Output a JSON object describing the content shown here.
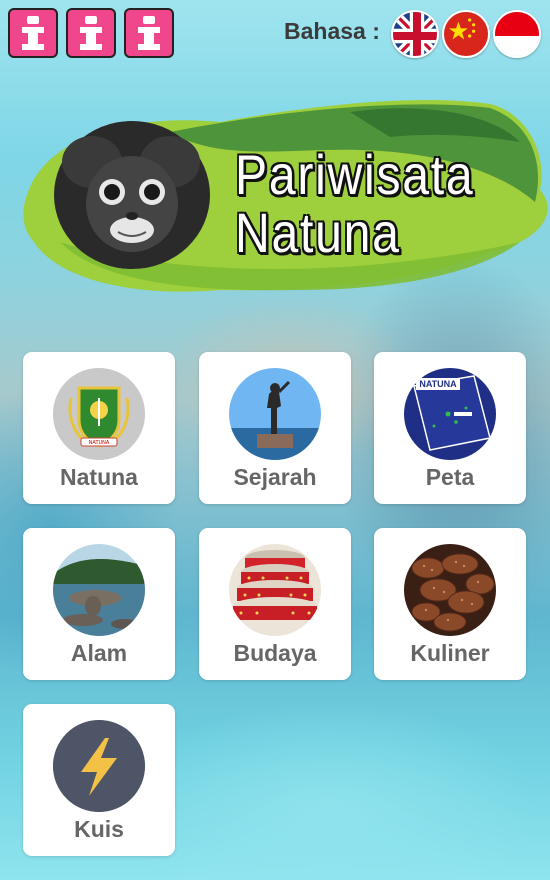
{
  "header": {
    "info_buttons": [
      "info-icon",
      "info-icon",
      "info-icon"
    ],
    "language_label": "Bahasa :",
    "flags": [
      "uk-flag-icon",
      "china-flag-icon",
      "indonesia-flag-icon"
    ]
  },
  "banner": {
    "title_line1": "Pariwisata",
    "title_line2": "Natuna"
  },
  "menu": [
    {
      "label": "Natuna",
      "icon": "natuna-emblem-icon"
    },
    {
      "label": "Sejarah",
      "icon": "statue-photo"
    },
    {
      "label": "Peta",
      "icon": "map-icon"
    },
    {
      "label": "Alam",
      "icon": "nature-photo"
    },
    {
      "label": "Budaya",
      "icon": "drums-photo"
    },
    {
      "label": "Kuliner",
      "icon": "food-photo"
    },
    {
      "label": "Kuis",
      "icon": "lightning-icon"
    }
  ],
  "map_thumb": {
    "title": "NATUNA"
  },
  "emblem": {
    "ribbon_text": "NATUNA"
  },
  "colors": {
    "info_button": "#f0468c",
    "kuis_circle": "#4e5566",
    "lightning": "#f3c146"
  }
}
